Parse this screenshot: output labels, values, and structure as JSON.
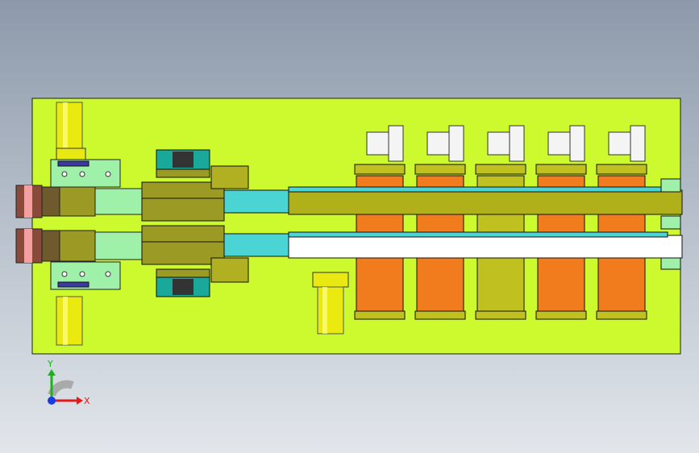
{
  "viewport": {
    "background": "gradient-grey-blue",
    "colors": {
      "base_plate": "#ccfa2f",
      "olive": "#9a9a24",
      "olive_dark": "#7a7a10",
      "orange": "#f07c1e",
      "cyan": "#4ad4d4",
      "teal": "#1aa89a",
      "yellow": "#ecec10",
      "mint": "#9ff0a8",
      "outline": "#1d1d1d"
    }
  },
  "model": {
    "name_icons": [
      "base-plate",
      "conveyor",
      "cylinder",
      "motor",
      "sort-bin"
    ],
    "motor_count": 5,
    "bin_count": 5,
    "bins_filled": [
      "orange",
      "orange",
      "olive",
      "orange",
      "orange"
    ]
  },
  "triad": {
    "x_label": "X",
    "y_label": "Y",
    "colors": {
      "x": "#e41a1a",
      "y": "#19b419",
      "z": "#1a3ae4"
    }
  }
}
